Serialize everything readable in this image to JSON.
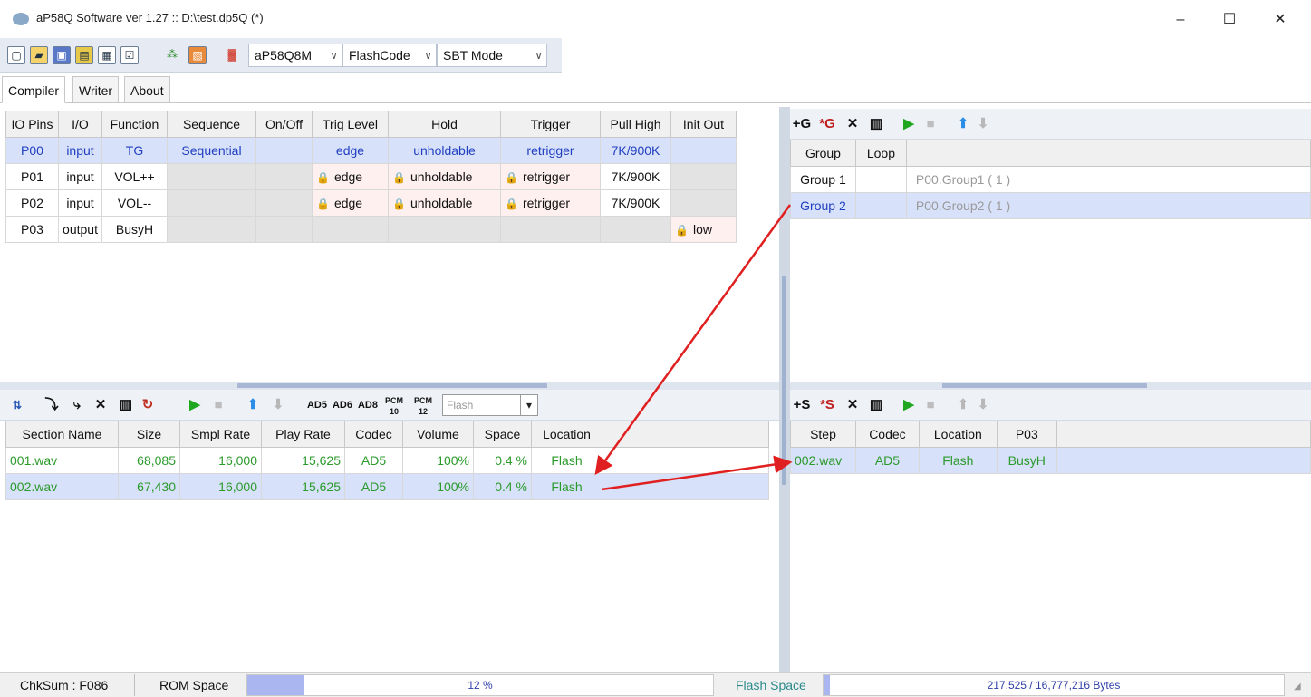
{
  "window": {
    "title": "aP58Q Software ver 1.27 :: D:\\test.dp5Q (*)",
    "controls": [
      "–",
      "☐",
      "✕"
    ]
  },
  "toolbar": {
    "icons": [
      "new-file-icon",
      "open-folder-icon",
      "save-icon",
      "save-as-icon",
      "compile-icon",
      "settings-icon",
      "connect-icon",
      "export-icon",
      "chip-icon"
    ],
    "chip_combo": "aP58Q8M",
    "code_combo": "FlashCode",
    "mode_combo": "SBT Mode"
  },
  "tabs": [
    "Compiler",
    "Writer",
    "About"
  ],
  "io_table": {
    "headers": [
      "IO Pins",
      "I/O",
      "Function",
      "Sequence",
      "On/Off",
      "Trig Level",
      "Hold",
      "Trigger",
      "Pull High",
      "Init Out"
    ],
    "rows": [
      {
        "pin": "P00",
        "io": "input",
        "function": "TG",
        "sequence": "Sequential",
        "onoff": "",
        "trig_level": "edge",
        "hold": "unholdable",
        "trigger": "retrigger",
        "pull_high": "7K/900K",
        "init_out": ""
      },
      {
        "pin": "P01",
        "io": "input",
        "function": "VOL++",
        "sequence": "",
        "onoff": "",
        "trig_level": "edge",
        "hold": "unholdable",
        "trigger": "retrigger",
        "pull_high": "7K/900K",
        "init_out": ""
      },
      {
        "pin": "P02",
        "io": "input",
        "function": "VOL--",
        "sequence": "",
        "onoff": "",
        "trig_level": "edge",
        "hold": "unholdable",
        "trigger": "retrigger",
        "pull_high": "7K/900K",
        "init_out": ""
      },
      {
        "pin": "P03",
        "io": "output",
        "function": "BusyH",
        "sequence": "",
        "onoff": "",
        "trig_level": "",
        "hold": "",
        "trigger": "",
        "pull_high": "",
        "init_out": "low"
      }
    ]
  },
  "group_toolbar": {
    "add_label": "+G",
    "insert_label": "*G"
  },
  "group_table": {
    "headers": [
      "Group",
      "Loop",
      ""
    ],
    "rows": [
      {
        "group": "Group 1",
        "loop": "",
        "desc": "P00.Group1 ( 1 )"
      },
      {
        "group": "Group 2",
        "loop": "",
        "desc": "P00.Group2 ( 1 )"
      }
    ]
  },
  "section_toolbar": {
    "codec_buttons": [
      "AD5",
      "AD6",
      "AD8",
      "PCM 10",
      "PCM 12"
    ],
    "location_combo": "Flash"
  },
  "section_table": {
    "headers": [
      "Section Name",
      "Size",
      "Smpl Rate",
      "Play Rate",
      "Codec",
      "Volume",
      "Space",
      "Location"
    ],
    "rows": [
      {
        "name": "001.wav",
        "size": "68,085",
        "smpl": "16,000",
        "play": "15,625",
        "codec": "AD5",
        "volume": "100%",
        "space": "0.4 %",
        "location": "Flash"
      },
      {
        "name": "002.wav",
        "size": "67,430",
        "smpl": "16,000",
        "play": "15,625",
        "codec": "AD5",
        "volume": "100%",
        "space": "0.4 %",
        "location": "Flash"
      }
    ]
  },
  "step_toolbar": {
    "add_label": "+S",
    "insert_label": "*S"
  },
  "step_table": {
    "headers": [
      "Step",
      "Codec",
      "Location",
      "P03"
    ],
    "rows": [
      {
        "step": "002.wav",
        "codec": "AD5",
        "location": "Flash",
        "p03": "BusyH"
      }
    ]
  },
  "status": {
    "checksum": "ChkSum : F086",
    "rom_label": "ROM Space",
    "rom_percent": "12 %",
    "rom_fraction": 0.12,
    "flash_label": "Flash Space",
    "flash_value": "217,525 / 16,777,216 Bytes",
    "flash_fraction": 0.013
  },
  "colors": {
    "selection": "#d8e1fa",
    "blue_text": "#1f3fc0",
    "green_text": "#2a9a2a",
    "lock": "#d0202a",
    "annotation_arrow": "#e02020"
  }
}
